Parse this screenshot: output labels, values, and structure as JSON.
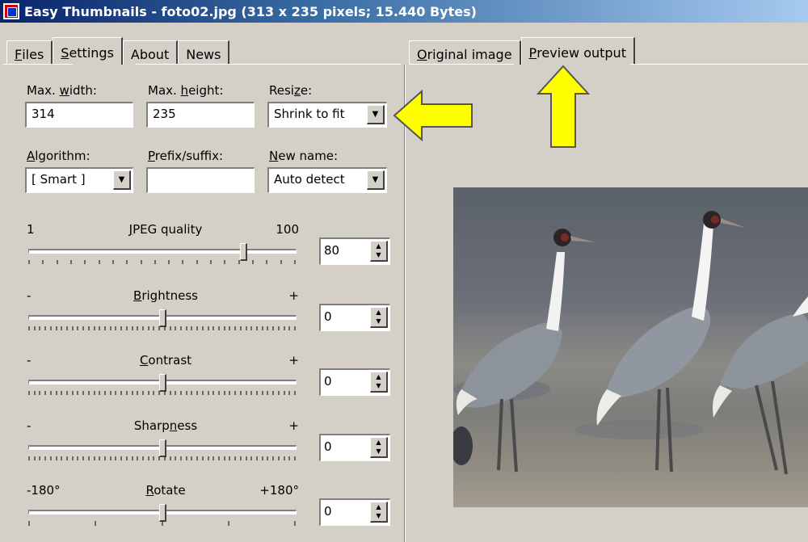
{
  "window": {
    "title": "Easy Thumbnails - foto02.jpg  (313 x 235 pixels;  15.440 Bytes)"
  },
  "left_tabs": [
    {
      "label": "Files",
      "ul": "F",
      "rest": "iles"
    },
    {
      "label": "Settings",
      "ul": "S",
      "rest": "ettings"
    },
    {
      "label": "About",
      "ul": "",
      "rest": "About"
    },
    {
      "label": "News",
      "ul": "",
      "rest": "News"
    }
  ],
  "right_tabs": [
    {
      "label": "Original image",
      "ul": "O",
      "rest": "riginal image"
    },
    {
      "label": "Preview output",
      "ul": "P",
      "rest": "review output"
    }
  ],
  "fields": {
    "max_width": {
      "label_pre": "Max. ",
      "label_ul": "w",
      "label_post": "idth:",
      "value": "314"
    },
    "max_height": {
      "label_pre": "Max. ",
      "label_ul": "h",
      "label_post": "eight:",
      "value": "235"
    },
    "resize": {
      "label_pre": "Resi",
      "label_ul": "z",
      "label_post": "e:",
      "value": "Shrink to fit"
    },
    "algorithm": {
      "label_pre": "",
      "label_ul": "A",
      "label_post": "lgorithm:",
      "value": "[ Smart ]"
    },
    "prefix_suffix": {
      "label_pre": "",
      "label_ul": "P",
      "label_post": "refix/suffix:",
      "value": ""
    },
    "new_name": {
      "label_pre": "",
      "label_ul": "N",
      "label_post": "ew name:",
      "value": "Auto detect"
    }
  },
  "sliders": {
    "jpeg": {
      "min_label": "1",
      "label_ul": "J",
      "label_rest": "PEG quality",
      "max_label": "100",
      "value": "80",
      "level": 0.8
    },
    "brightness": {
      "min_label": "-",
      "label_ul": "B",
      "label_rest": "rightness",
      "max_label": "+",
      "value": "0",
      "level": 0.5
    },
    "contrast": {
      "min_label": "-",
      "label_ul": "C",
      "label_rest": "ontrast",
      "max_label": "+",
      "value": "0",
      "level": 0.5
    },
    "sharpness": {
      "min_label": "-",
      "label_pre": "Sharp",
      "label_ul": "n",
      "label_rest": "ess",
      "max_label": "+",
      "value": "0",
      "level": 0.5
    },
    "rotate": {
      "min_label": "-180°",
      "label_ul": "R",
      "label_rest": "otate",
      "max_label": "+180°",
      "value": "0",
      "level": 0.5
    }
  },
  "colors": {
    "arrow": "#ffff00",
    "titlebar": "#0a246a",
    "face": "#d4d0c8"
  },
  "icons": {
    "dropdown": "chevron-down-icon",
    "spinner": "spin-arrows-icon"
  }
}
